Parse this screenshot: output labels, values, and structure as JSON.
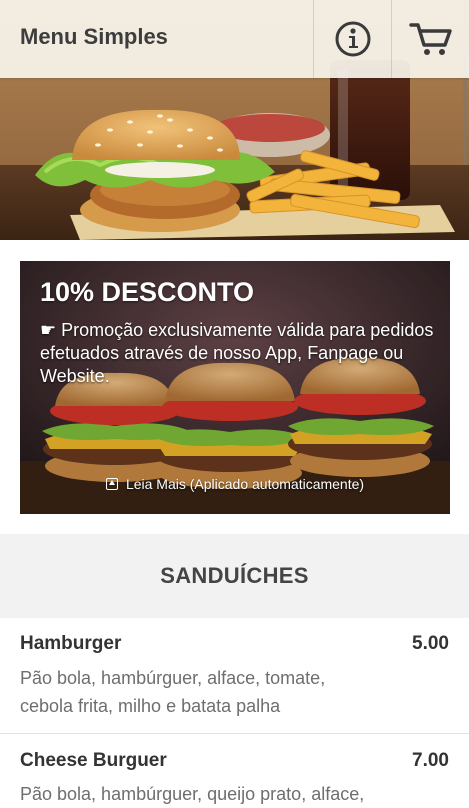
{
  "header": {
    "title": "Menu Simples",
    "info_icon": "info-icon",
    "cart_icon": "cart-icon"
  },
  "promo": {
    "heading": "10% DESCONTO",
    "text": "☛ Promoção exclusivamente válida para pedidos efetuados através de nosso App, Fanpage ou Website.",
    "read_more": "Leia Mais (Aplicado automaticamente)"
  },
  "section": {
    "title": "SANDUÍCHES"
  },
  "items": [
    {
      "name": "Hamburger",
      "price": "5.00",
      "description": "Pão bola, hambúrguer, alface, tomate, cebola frita, milho e batata palha"
    },
    {
      "name": "Cheese Burguer",
      "price": "7.00",
      "description": "Pão bola, hambúrguer, queijo prato, alface,"
    }
  ],
  "colors": {
    "header_bg": "#f8f4ec",
    "section_bg": "#f2f2f2",
    "text": "#333333",
    "muted_text": "#6e6e6e"
  }
}
